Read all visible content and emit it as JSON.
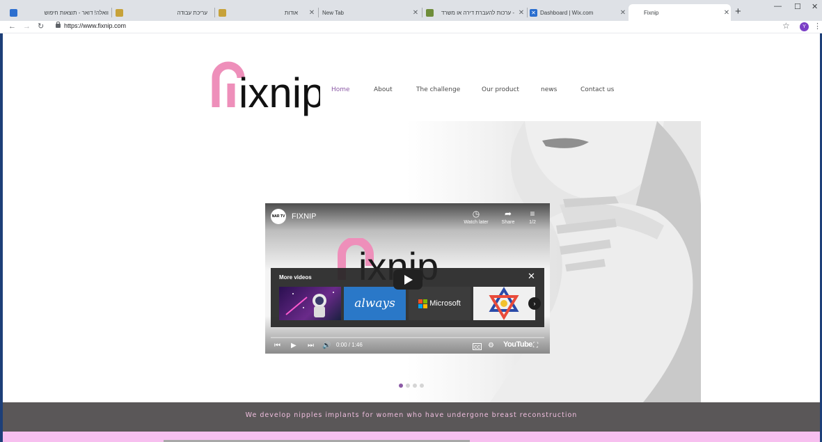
{
  "browser": {
    "tabs": [
      {
        "title": "וואלה! דואר - תוצאות חיפוש",
        "fav": "#2d6fcf"
      },
      {
        "title": "עריכת עבודה",
        "fav": "#c7a23a"
      },
      {
        "title": "אודות",
        "fav": "#c7a23a"
      },
      {
        "title": "New Tab",
        "fav": ""
      },
      {
        "title": "ערכות להעברת דירה או משרד - ",
        "fav": "#6f8d3a"
      },
      {
        "title": "Dashboard | Wix.com",
        "fav": "#2a6ecf"
      },
      {
        "title": "Fixnip",
        "fav": ""
      }
    ],
    "new_tab_glyph": "+",
    "url": "https://www.fixnip.com",
    "profile_initial": "Y"
  },
  "site": {
    "logo": {
      "text": "ixnip",
      "accent": "#ee8fba"
    },
    "nav": [
      "Home",
      "About",
      "The challenge",
      "Our product",
      "news",
      "Contact us"
    ],
    "nav_active_color": "#8c5aa6",
    "slides": {
      "count": 4,
      "active": 1
    },
    "tagline": "We develop nipples implants for women who have undergone breast reconstruction"
  },
  "video": {
    "channel_badge": "NAR TV",
    "title": "FIXNIP",
    "actions": [
      {
        "icon": "clock-icon",
        "label": "Watch later"
      },
      {
        "icon": "share-icon",
        "label": "Share"
      },
      {
        "icon": "playlist-icon",
        "label": "1/2"
      }
    ],
    "more_videos_label": "More videos",
    "thumbnails": [
      {
        "name": "space",
        "text": ""
      },
      {
        "name": "always",
        "text": "always"
      },
      {
        "name": "microsoft",
        "text": "Microsoft"
      },
      {
        "name": "star",
        "text": ""
      }
    ],
    "time": "0:00 / 1:46",
    "brand": "YouTube"
  }
}
